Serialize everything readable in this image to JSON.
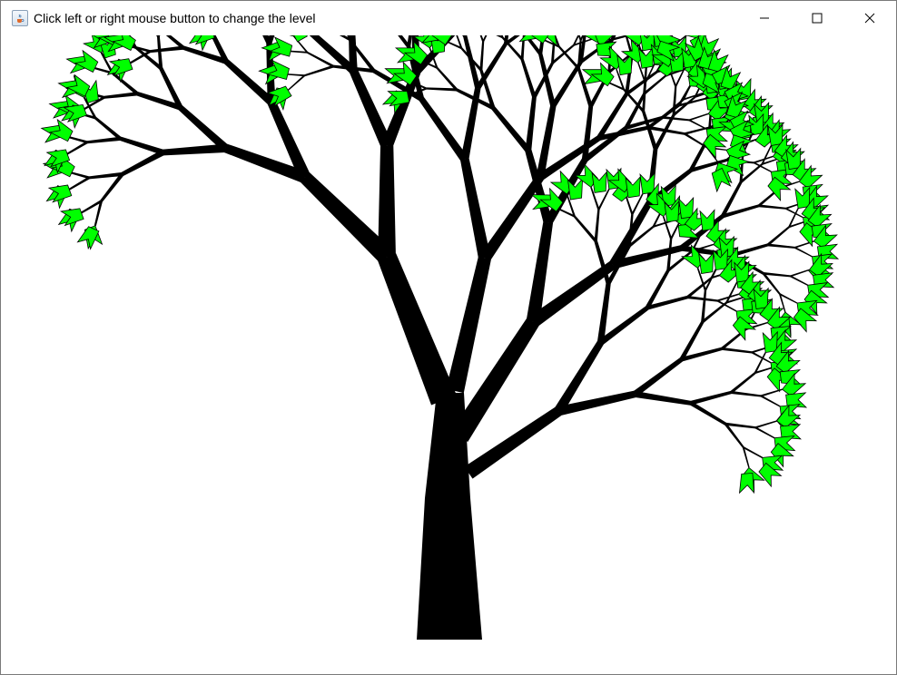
{
  "window": {
    "title": "Click left or right mouse button to change the level",
    "controls": {
      "minimize_icon": "minimize-icon",
      "maximize_icon": "maximize-icon",
      "close_icon": "close-icon"
    },
    "app_icon": "java-cup-icon"
  },
  "canvas": {
    "background": "#ffffff",
    "trunk_color": "#000000",
    "leaf_color": "#00ff00",
    "leaf_outline": "#000000"
  }
}
